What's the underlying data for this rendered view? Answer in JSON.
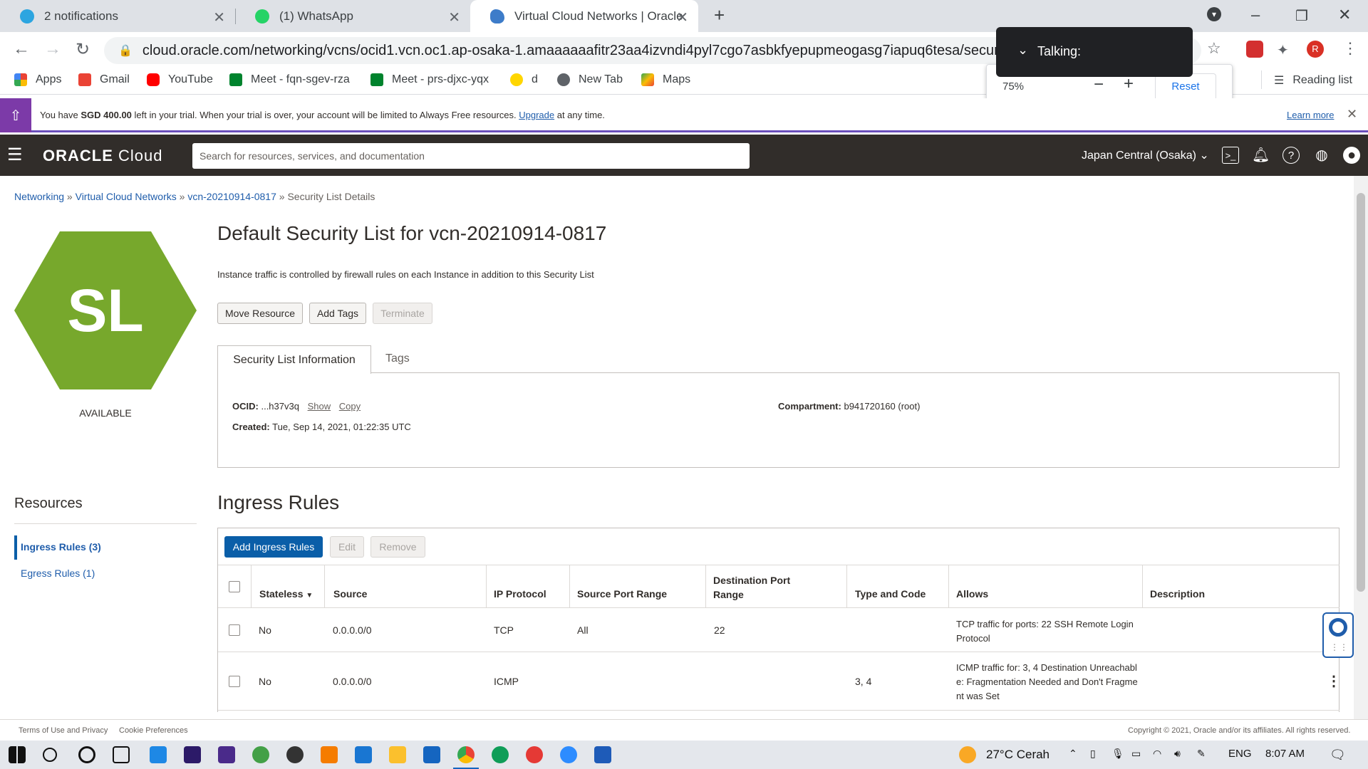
{
  "browser": {
    "tabs": [
      {
        "title": "2 notifications",
        "color": "#2ca5e0"
      },
      {
        "title": "(1) WhatsApp",
        "color": "#25d366"
      },
      {
        "title": "Virtual Cloud Networks | Oracle C",
        "color": "#3d7cc9"
      }
    ],
    "url": "cloud.oracle.com/networking/vcns/ocid1.vcn.oc1.ap-osaka-1.amaaaaaafitr23aa4izvndi4pyl7cgo7asbkfyepupmeogasg7iapuq6tesa/security-lists/o",
    "bookmarks": [
      "Apps",
      "Gmail",
      "YouTube",
      "Meet - fqn-sgev-rza",
      "Meet - prs-djxc-yqx",
      "d",
      "New Tab",
      "Maps"
    ],
    "reading_list": "Reading list",
    "zoom": {
      "value": "75%",
      "reset": "Reset"
    },
    "talking_popup": "Talking:"
  },
  "trial_banner": {
    "prefix": "You have ",
    "amount": "SGD 400.00",
    "middle": " left in your trial. When your trial is over, your account will be limited to Always Free resources. ",
    "upgrade": "Upgrade",
    "suffix": " at any time.",
    "learn_more": "Learn more"
  },
  "header": {
    "brand": "ORACLE",
    "brand_suffix": " Cloud",
    "search_placeholder": "Search for resources, services, and documentation",
    "region": "Japan Central (Osaka)"
  },
  "breadcrumb": {
    "items": [
      "Networking",
      "Virtual Cloud Networks",
      "vcn-20210914-0817"
    ],
    "current": "Security List Details"
  },
  "resource": {
    "badge": "SL",
    "status": "AVAILABLE",
    "status_color": "#77a82c",
    "title": "Default Security List for vcn-20210914-0817",
    "description": "Instance traffic is controlled by firewall rules on each Instance in addition to this Security List",
    "actions": [
      "Move Resource",
      "Add Tags",
      "Terminate"
    ]
  },
  "info_tabs": [
    "Security List Information",
    "Tags"
  ],
  "info": {
    "ocid_label": "OCID:",
    "ocid_value": "...h37v3q",
    "show": "Show",
    "copy": "Copy",
    "created_label": "Created:",
    "created_value": "Tue, Sep 14, 2021, 01:22:35 UTC",
    "compartment_label": "Compartment:",
    "compartment_value": "b941720160 (root)"
  },
  "resources": {
    "heading": "Resources",
    "items": [
      "Ingress Rules (3)",
      "Egress Rules (1)"
    ]
  },
  "ingress": {
    "heading": "Ingress Rules",
    "buttons": [
      "Add Ingress Rules",
      "Edit",
      "Remove"
    ],
    "columns": [
      "Stateless",
      "Source",
      "IP Protocol",
      "Source Port Range",
      "Destination Port Range",
      "Type and Code",
      "Allows",
      "Description"
    ],
    "rows": [
      {
        "stateless": "No",
        "source": "0.0.0.0/0",
        "protocol": "TCP",
        "src_port": "All",
        "dst_port": "22",
        "type_code": "",
        "allows": "TCP traffic for ports: 22 SSH Remote Login Protocol",
        "description": ""
      },
      {
        "stateless": "No",
        "source": "0.0.0.0/0",
        "protocol": "ICMP",
        "src_port": "",
        "dst_port": "",
        "type_code": "3, 4",
        "allows": "ICMP traffic for: 3, 4 Destination Unreachable: Fragmentation Needed and Don't Fragment was Set",
        "description": ""
      }
    ]
  },
  "footer": {
    "terms": "Terms of Use and Privacy",
    "cookies": "Cookie Preferences",
    "copyright": "Copyright © 2021, Oracle and/or its affiliates. All rights reserved."
  },
  "taskbar": {
    "weather": "27°C Cerah",
    "lang": "ENG",
    "time": "8:07 AM"
  }
}
